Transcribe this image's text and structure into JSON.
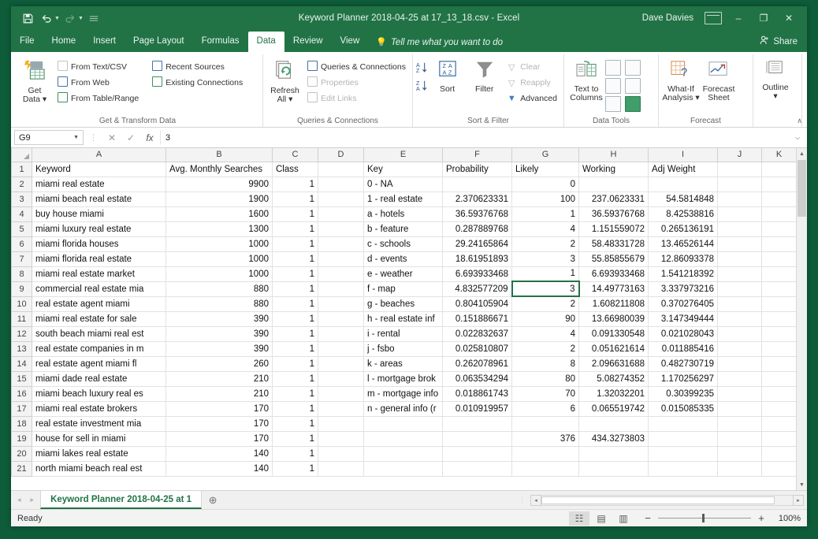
{
  "titlebar": {
    "title": "Keyword Planner 2018-04-25 at 17_13_18.csv  -  Excel",
    "user": "Dave Davies",
    "qat": [
      {
        "name": "save-icon",
        "glyph": "⬜"
      },
      {
        "name": "undo-icon",
        "glyph": "↶"
      },
      {
        "name": "redo-icon",
        "glyph": "↷"
      },
      {
        "name": "customize-qat-icon",
        "glyph": "☰"
      }
    ],
    "minimize_label": "–",
    "restore_label": "❐",
    "close_label": "✕"
  },
  "tabs": [
    {
      "label": "File",
      "active": false
    },
    {
      "label": "Home",
      "active": false
    },
    {
      "label": "Insert",
      "active": false
    },
    {
      "label": "Page Layout",
      "active": false
    },
    {
      "label": "Formulas",
      "active": false
    },
    {
      "label": "Data",
      "active": true
    },
    {
      "label": "Review",
      "active": false
    },
    {
      "label": "View",
      "active": false
    }
  ],
  "tellme": {
    "label": "Tell me what you want to do"
  },
  "share": {
    "label": "Share"
  },
  "ribbon": {
    "groups": [
      {
        "title": "Get & Transform Data",
        "big": {
          "label_line1": "Get",
          "label_line2": "Data ▾"
        },
        "col1": [
          {
            "label": "From Text/CSV"
          },
          {
            "label": "From Web"
          },
          {
            "label": "From Table/Range"
          }
        ],
        "col2": [
          {
            "label": "Recent Sources"
          },
          {
            "label": "Existing Connections"
          }
        ]
      },
      {
        "title": "Queries & Connections",
        "big": {
          "label_line1": "Refresh",
          "label_line2": "All ▾"
        },
        "col1": [
          {
            "label": "Queries & Connections",
            "dim": false
          },
          {
            "label": "Properties",
            "dim": true
          },
          {
            "label": "Edit Links",
            "dim": true
          }
        ]
      },
      {
        "title": "Sort & Filter",
        "sort_label": "Sort",
        "filter_label": "Filter",
        "col1": [
          {
            "label": "Clear",
            "dim": true
          },
          {
            "label": "Reapply",
            "dim": true
          },
          {
            "label": "Advanced",
            "dim": false
          }
        ]
      },
      {
        "title": "Data Tools",
        "text_to_columns_line1": "Text to",
        "text_to_columns_line2": "Columns"
      },
      {
        "title": "Forecast",
        "whatif_line1": "What-If",
        "whatif_line2": "Analysis ▾",
        "forecast_line1": "Forecast",
        "forecast_line2": "Sheet"
      },
      {
        "title": "",
        "outline_line1": "Outline",
        "outline_line2": "▾"
      }
    ],
    "collapse_label": "∧"
  },
  "formulabar": {
    "namebox_value": "G9",
    "cancel_label": "✕",
    "confirm_label": "✓",
    "fx_label": "fx",
    "formula_value": "3",
    "expand_label": "⌵"
  },
  "sheet": {
    "columns": [
      "A",
      "B",
      "C",
      "D",
      "E",
      "F",
      "G",
      "H",
      "I",
      "J",
      "K"
    ],
    "selected_cell": "G9",
    "rows": [
      {
        "n": "1",
        "A": "Keyword",
        "B": "Avg. Monthly Searches",
        "C": "Class",
        "D": "",
        "E": "Key",
        "F": "Probability",
        "G": "Likely",
        "H": "Working",
        "I": "Adj Weight",
        "J": "",
        "K": ""
      },
      {
        "n": "2",
        "A": "miami real estate",
        "B": "9900",
        "C": "1",
        "D": "",
        "E": "0 - NA",
        "F": "",
        "G": "0",
        "H": "",
        "I": "",
        "J": "",
        "K": ""
      },
      {
        "n": "3",
        "A": "miami beach real estate",
        "B": "1900",
        "C": "1",
        "D": "",
        "E": "1 - real estate",
        "F": "2.370623331",
        "G": "100",
        "H": "237.0623331",
        "I": "54.5814848",
        "J": "",
        "K": ""
      },
      {
        "n": "4",
        "A": "buy house miami",
        "B": "1600",
        "C": "1",
        "D": "",
        "E": "a - hotels",
        "F": "36.59376768",
        "G": "1",
        "H": "36.59376768",
        "I": "8.42538816",
        "J": "",
        "K": ""
      },
      {
        "n": "5",
        "A": "miami luxury real estate",
        "B": "1300",
        "C": "1",
        "D": "",
        "E": "b - feature",
        "F": "0.287889768",
        "G": "4",
        "H": "1.151559072",
        "I": "0.265136191",
        "J": "",
        "K": ""
      },
      {
        "n": "6",
        "A": "miami florida houses",
        "B": "1000",
        "C": "1",
        "D": "",
        "E": "c - schools",
        "F": "29.24165864",
        "G": "2",
        "H": "58.48331728",
        "I": "13.46526144",
        "J": "",
        "K": ""
      },
      {
        "n": "7",
        "A": "miami florida real estate",
        "B": "1000",
        "C": "1",
        "D": "",
        "E": "d - events",
        "F": "18.61951893",
        "G": "3",
        "H": "55.85855679",
        "I": "12.86093378",
        "J": "",
        "K": ""
      },
      {
        "n": "8",
        "A": "miami real estate market",
        "B": "1000",
        "C": "1",
        "D": "",
        "E": "e - weather",
        "F": "6.693933468",
        "G": "1",
        "H": "6.693933468",
        "I": "1.541218392",
        "J": "",
        "K": ""
      },
      {
        "n": "9",
        "A": "commercial real estate mia",
        "B": "880",
        "C": "1",
        "D": "",
        "E": "f - map",
        "F": "4.832577209",
        "G": "3",
        "H": "14.49773163",
        "I": "3.337973216",
        "J": "",
        "K": ""
      },
      {
        "n": "10",
        "A": "real estate agent miami",
        "B": "880",
        "C": "1",
        "D": "",
        "E": "g - beaches",
        "F": "0.804105904",
        "G": "2",
        "H": "1.608211808",
        "I": "0.370276405",
        "J": "",
        "K": ""
      },
      {
        "n": "11",
        "A": "miami real estate for sale",
        "B": "390",
        "C": "1",
        "D": "",
        "E": "h - real estate inf",
        "F": "0.151886671",
        "G": "90",
        "H": "13.66980039",
        "I": "3.147349444",
        "J": "",
        "K": ""
      },
      {
        "n": "12",
        "A": "south beach miami real est",
        "B": "390",
        "C": "1",
        "D": "",
        "E": "i - rental",
        "F": "0.022832637",
        "G": "4",
        "H": "0.091330548",
        "I": "0.021028043",
        "J": "",
        "K": ""
      },
      {
        "n": "13",
        "A": "real estate companies in m",
        "B": "390",
        "C": "1",
        "D": "",
        "E": "j - fsbo",
        "F": "0.025810807",
        "G": "2",
        "H": "0.051621614",
        "I": "0.011885416",
        "J": "",
        "K": ""
      },
      {
        "n": "14",
        "A": "real estate agent miami fl",
        "B": "260",
        "C": "1",
        "D": "",
        "E": "k - areas",
        "F": "0.262078961",
        "G": "8",
        "H": "2.096631688",
        "I": "0.482730719",
        "J": "",
        "K": ""
      },
      {
        "n": "15",
        "A": "miami dade real estate",
        "B": "210",
        "C": "1",
        "D": "",
        "E": "l - mortgage brok",
        "F": "0.063534294",
        "G": "80",
        "H": "5.08274352",
        "I": "1.170256297",
        "J": "",
        "K": ""
      },
      {
        "n": "16",
        "A": "miami beach luxury real es",
        "B": "210",
        "C": "1",
        "D": "",
        "E": "m - mortgage info",
        "F": "0.018861743",
        "G": "70",
        "H": "1.32032201",
        "I": "0.30399235",
        "J": "",
        "K": ""
      },
      {
        "n": "17",
        "A": "miami real estate brokers",
        "B": "170",
        "C": "1",
        "D": "",
        "E": "n - general info (r",
        "F": "0.010919957",
        "G": "6",
        "H": "0.065519742",
        "I": "0.015085335",
        "J": "",
        "K": ""
      },
      {
        "n": "18",
        "A": "real estate investment mia",
        "B": "170",
        "C": "1",
        "D": "",
        "E": "",
        "F": "",
        "G": "",
        "H": "",
        "I": "",
        "J": "",
        "K": ""
      },
      {
        "n": "19",
        "A": "house for sell in miami",
        "B": "170",
        "C": "1",
        "D": "",
        "E": "",
        "F": "",
        "G": "376",
        "H": "434.3273803",
        "I": "",
        "J": "",
        "K": ""
      },
      {
        "n": "20",
        "A": "miami lakes real estate",
        "B": "140",
        "C": "1",
        "D": "",
        "E": "",
        "F": "",
        "G": "",
        "H": "",
        "I": "",
        "J": "",
        "K": ""
      },
      {
        "n": "21",
        "A": "north miami beach real est",
        "B": "140",
        "C": "1",
        "D": "",
        "E": "",
        "F": "",
        "G": "",
        "H": "",
        "I": "",
        "J": "",
        "K": ""
      }
    ]
  },
  "sheetbar": {
    "prev_label": "◂",
    "next_label": "▸",
    "tab_label": "Keyword Planner 2018-04-25 at 1",
    "add_label": "⊕",
    "hs_left": "◂",
    "hs_right": "▸"
  },
  "statusbar": {
    "status": "Ready",
    "views": [
      {
        "name": "normal-view-icon",
        "glyph": "☷",
        "active": true
      },
      {
        "name": "page-layout-view-icon",
        "glyph": "▤",
        "active": false
      },
      {
        "name": "page-break-view-icon",
        "glyph": "▥",
        "active": false
      }
    ],
    "zoom_out_label": "−",
    "zoom_in_label": "+",
    "zoom_level": "100%"
  }
}
